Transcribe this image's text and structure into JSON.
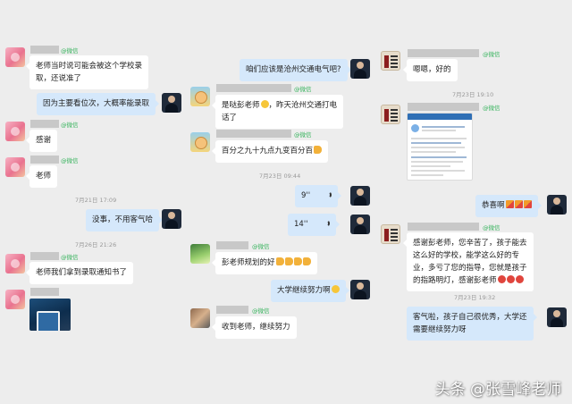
{
  "badge_wechat": "@微信",
  "voice_icon": "voice-wave-icon",
  "colors": {
    "sent_bubble": "#d5e8fb",
    "received_bubble": "#ffffff",
    "background": "#ededed",
    "wechat_badge": "#36b35c"
  },
  "panel1": {
    "m1": "老师当时说可能会被这个学校录",
    "m1b": "取，还说准了",
    "m2": "因为主要看位次，大概率能录取",
    "m3": "感谢",
    "m4": "老师",
    "t1": "7月21日 17:09",
    "m5": "没事，不用客气哈",
    "t2": "7月26日 21:26",
    "m6": "老师我们拿到录取通知书了"
  },
  "panel2": {
    "m1": "咱们应该是沧州交通电气吧?",
    "m2": "是哒彭老师",
    "m2b": "，昨天沧州交通打电",
    "m2c": "话了",
    "m3": "百分之九十九点九变百分百",
    "t1": "7月23日 09:44",
    "v1": "9''",
    "v2": "14''",
    "m4": "彭老师规划的好",
    "m5": "大学继续努力啊",
    "m6": "收到老师，继续努力"
  },
  "panel3": {
    "m1": "嗯嗯，好的",
    "t1": "7月23日 19:10",
    "m2": "恭喜啊",
    "m3a": "感谢彭老师，您辛苦了，孩子能去",
    "m3b": "这么好的学校，能学这么好的专",
    "m3c": "业，多亏了您的指导，您就是孩子",
    "m3d": "的指路明灯，感谢彭老师",
    "t2": "7月23日 19:32",
    "m4a": "客气啦，孩子自己很优秀，大学还",
    "m4b": "需要继续努力呀"
  },
  "watermark": "头条 @张雪峰老师"
}
